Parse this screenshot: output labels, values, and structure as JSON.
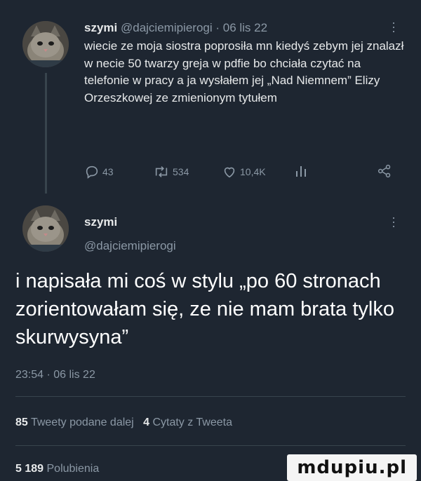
{
  "tweet1": {
    "name": "szymi",
    "handle": "@dajciemipierogi",
    "date": " · 06 lis 22",
    "text": "wiecie ze moja siostra poprosiła mn kiedyś zebym jej znalazł w necie 50 twarzy greja w pdfie bo chciała czytać na telefonie w pracy a ja wysłałem jej „Nad Niemnem” Elizy Orzeszkowej ze zmienionym tytułem",
    "replies": "43",
    "retweets": "534",
    "likes": "10,4K"
  },
  "tweet2": {
    "name": "szymi",
    "handle": "@dajciemipierogi",
    "text": "i napisała mi coś w stylu „po 60 stronach zorientowałam się, ze nie mam brata tylko skurwysyna”",
    "timestamp": "23:54 · 06 lis 22"
  },
  "stats": {
    "quote_count": "85",
    "quote_label": "Tweety podane dalej",
    "cite_count": "4",
    "cite_label": "Cytaty z Tweeta",
    "likes_count": "5 189",
    "likes_label": "Polubienia"
  },
  "watermark": "mdupiu.pl",
  "colors": {
    "background": "#1e2631",
    "text": "#e7e9ea",
    "secondary": "#8b98a5",
    "divider": "#38444d"
  },
  "icons": [
    "reply-icon",
    "retweet-icon",
    "like-icon",
    "analytics-icon",
    "share-icon",
    "more-icon"
  ]
}
